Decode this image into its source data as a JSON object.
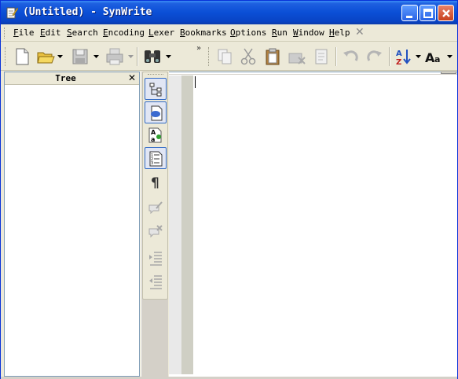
{
  "window": {
    "title": "(Untitled) - SynWrite"
  },
  "menu": {
    "items": [
      {
        "u": "F",
        "rest": "ile"
      },
      {
        "u": "E",
        "rest": "dit"
      },
      {
        "u": "S",
        "rest": "earch"
      },
      {
        "u": "E",
        "rest": "ncoding"
      },
      {
        "u": "L",
        "rest": "exer"
      },
      {
        "u": "B",
        "rest": "ookmarks"
      },
      {
        "u": "O",
        "rest": "ptions"
      },
      {
        "u": "R",
        "rest": "un"
      },
      {
        "u": "W",
        "rest": "indow"
      },
      {
        "u": "H",
        "rest": "elp"
      }
    ],
    "close_glyph": "✕"
  },
  "toolbar": {
    "overflow_glyph": "»"
  },
  "tree_panel": {
    "title": "Tree",
    "close_glyph": "✕"
  },
  "colors": {
    "title_bar": "#0a4fd6",
    "accent": "#316ac5",
    "chrome": "#ece9d8"
  }
}
